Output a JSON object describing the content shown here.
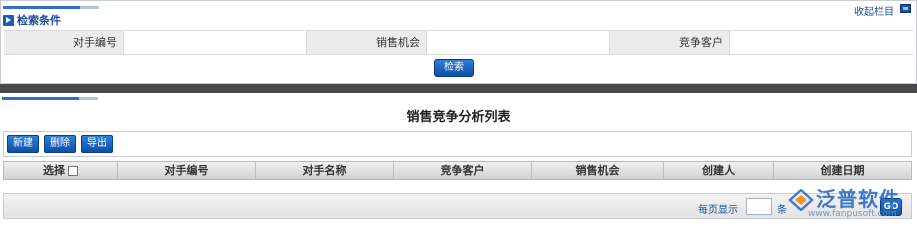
{
  "search_panel": {
    "title": "检索条件",
    "collapse_label": "收起栏目",
    "fields": [
      {
        "label": "对手编号",
        "value": ""
      },
      {
        "label": "销售机会",
        "value": ""
      },
      {
        "label": "竞争客户",
        "value": ""
      }
    ],
    "search_button": "检索"
  },
  "list_panel": {
    "title": "销售竞争分析列表",
    "toolbar": {
      "new": "新建",
      "delete": "删除",
      "export": "导出"
    },
    "columns": [
      "选择",
      "对手编号",
      "对手名称",
      "竞争客户",
      "销售机会",
      "创建人",
      "创建日期"
    ],
    "rows": []
  },
  "pager": {
    "per_page_label": "每页显示",
    "per_page_value": "",
    "unit": "条",
    "go_label": "GO"
  },
  "watermark": {
    "name": "泛普软件",
    "url": "www.fanpusoft.com"
  },
  "colors": {
    "accent_blue": "#1c4fa0",
    "button_blue": "#0f4ea6",
    "divider": "#4a4a4a"
  }
}
